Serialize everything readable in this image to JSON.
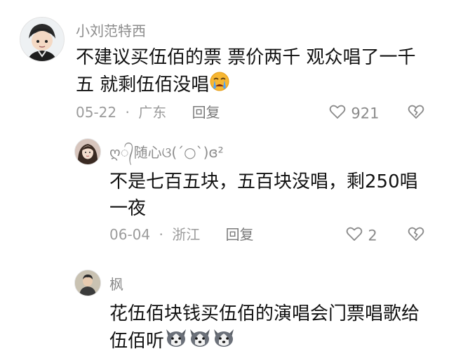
{
  "comments": [
    {
      "author": "小刘范特西",
      "text": "不建议买伍佰的票 票价两千 观众唱了一千五 就剩伍佰没唱",
      "emoji": "crying-face-icon",
      "date": "05-22",
      "separator": "·",
      "location": "广东",
      "reply_label": "回复",
      "likes": "921"
    },
    {
      "author": "ღ᭄随心ଓ(ˊ○ˋ)ɞ²",
      "text": "不是七百五块，五百块没唱，剩250唱一夜",
      "date": "06-04",
      "separator": "·",
      "location": "浙江",
      "reply_label": "回复",
      "likes": "2"
    },
    {
      "author": "枫",
      "text": "花伍佰块钱买伍佰的演唱会门票唱歌给伍佰听",
      "emoji": "husky-dog-icon",
      "emoji_count": 3
    }
  ],
  "colors": {
    "text": "#111111",
    "meta": "#9b9b9b",
    "crying_emoji": "#f7b733",
    "tear": "#4aa3ff"
  }
}
